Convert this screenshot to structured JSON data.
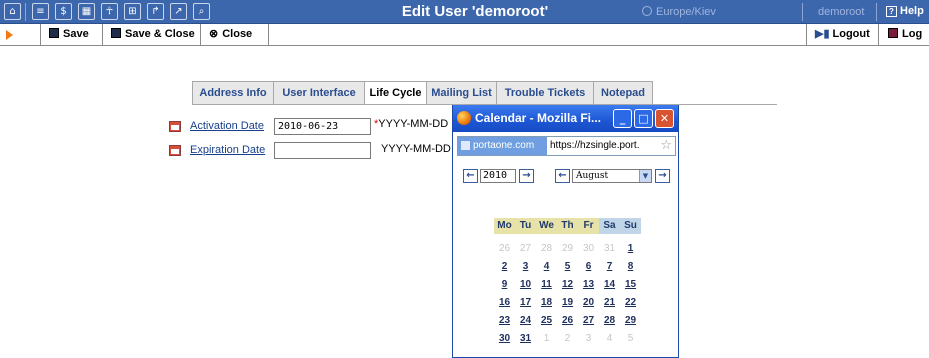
{
  "topbar": {
    "icons": [
      "home-icon",
      "list-icon",
      "dollar-icon",
      "grid-icon",
      "person-icon",
      "network-icon",
      "export-icon",
      "chart-icon",
      "search-icon"
    ],
    "title": "Edit User 'demoroot'",
    "timezone": "Europe/Kiev",
    "user": "demoroot",
    "help": "Help"
  },
  "toolbar": {
    "save": "Save",
    "save_close": "Save & Close",
    "close": "Close",
    "logout": "Logout",
    "log": "Log"
  },
  "tabs": [
    {
      "label": "Address Info"
    },
    {
      "label": "User Interface"
    },
    {
      "label": "Life Cycle",
      "active": true
    },
    {
      "label": "Mailing List"
    },
    {
      "label": "Trouble Tickets"
    },
    {
      "label": "Notepad"
    }
  ],
  "form": {
    "activation_label": "Activation Date",
    "activation_value": "2010-06-23",
    "activation_hint": "YYYY-MM-DD",
    "required_mark": "*",
    "expiration_label": "Expiration Date",
    "expiration_value": "",
    "expiration_hint": "YYYY-MM-DD"
  },
  "popup": {
    "title": "Calendar - Mozilla Fi...",
    "site": "portaone.com",
    "url": "https://hzsingle.port.",
    "year": "2010",
    "month": "August",
    "weekdays": [
      "Mo",
      "Tu",
      "We",
      "Th",
      "Fr",
      "Sa",
      "Su"
    ],
    "weeks": [
      [
        "26",
        "27",
        "28",
        "29",
        "30",
        "31",
        "1"
      ],
      [
        "2",
        "3",
        "4",
        "5",
        "6",
        "7",
        "8"
      ],
      [
        "9",
        "10",
        "11",
        "12",
        "13",
        "14",
        "15"
      ],
      [
        "16",
        "17",
        "18",
        "19",
        "20",
        "21",
        "22"
      ],
      [
        "23",
        "24",
        "25",
        "26",
        "27",
        "28",
        "29"
      ],
      [
        "30",
        "31",
        "1",
        "2",
        "3",
        "4",
        "5"
      ]
    ]
  },
  "colors": {
    "topbar_bg": "#3d67ad",
    "link": "#183f8c",
    "weekday_bg": "#e6e2a8",
    "weekend_bg": "#c0d6e8"
  }
}
